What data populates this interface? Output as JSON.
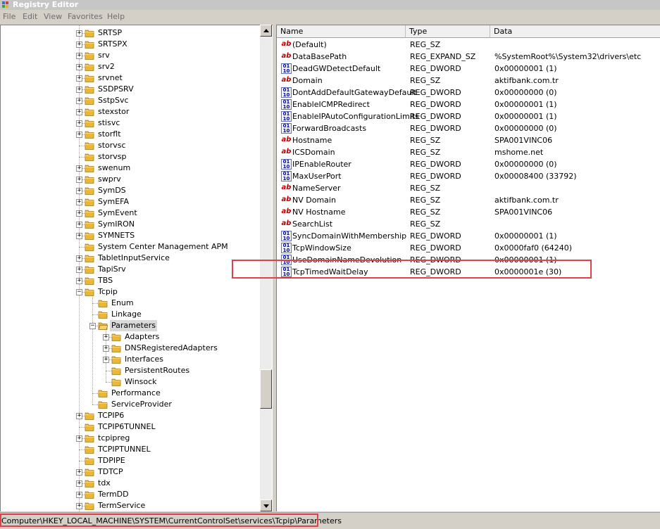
{
  "window": {
    "title": "Registry Editor"
  },
  "menu": [
    "File",
    "Edit",
    "View",
    "Favorites",
    "Help"
  ],
  "tree": [
    {
      "label": "SRTSP",
      "level": 0,
      "expander": "plus"
    },
    {
      "label": "SRTSPX",
      "level": 0,
      "expander": "plus"
    },
    {
      "label": "srv",
      "level": 0,
      "expander": "plus"
    },
    {
      "label": "srv2",
      "level": 0,
      "expander": "plus"
    },
    {
      "label": "srvnet",
      "level": 0,
      "expander": "plus"
    },
    {
      "label": "SSDPSRV",
      "level": 0,
      "expander": "plus"
    },
    {
      "label": "SstpSvc",
      "level": 0,
      "expander": "plus"
    },
    {
      "label": "stexstor",
      "level": 0,
      "expander": "plus"
    },
    {
      "label": "stisvc",
      "level": 0,
      "expander": "plus"
    },
    {
      "label": "storflt",
      "level": 0,
      "expander": "plus"
    },
    {
      "label": "storvsc",
      "level": 0,
      "expander": "none"
    },
    {
      "label": "storvsp",
      "level": 0,
      "expander": "none"
    },
    {
      "label": "swenum",
      "level": 0,
      "expander": "plus"
    },
    {
      "label": "swprv",
      "level": 0,
      "expander": "plus"
    },
    {
      "label": "SymDS",
      "level": 0,
      "expander": "plus"
    },
    {
      "label": "SymEFA",
      "level": 0,
      "expander": "plus"
    },
    {
      "label": "SymEvent",
      "level": 0,
      "expander": "plus"
    },
    {
      "label": "SymIRON",
      "level": 0,
      "expander": "plus"
    },
    {
      "label": "SYMNETS",
      "level": 0,
      "expander": "plus"
    },
    {
      "label": "System Center Management APM",
      "level": 0,
      "expander": "none"
    },
    {
      "label": "TabletInputService",
      "level": 0,
      "expander": "plus"
    },
    {
      "label": "TapiSrv",
      "level": 0,
      "expander": "plus"
    },
    {
      "label": "TBS",
      "level": 0,
      "expander": "plus"
    },
    {
      "label": "Tcpip",
      "level": 0,
      "expander": "minus"
    },
    {
      "label": "Enum",
      "level": 1,
      "expander": "none"
    },
    {
      "label": "Linkage",
      "level": 1,
      "expander": "none"
    },
    {
      "label": "Parameters",
      "level": 1,
      "expander": "minus",
      "selected": true
    },
    {
      "label": "Adapters",
      "level": 2,
      "expander": "plus"
    },
    {
      "label": "DNSRegisteredAdapters",
      "level": 2,
      "expander": "plus"
    },
    {
      "label": "Interfaces",
      "level": 2,
      "expander": "plus"
    },
    {
      "label": "PersistentRoutes",
      "level": 2,
      "expander": "none"
    },
    {
      "label": "Winsock",
      "level": 2,
      "expander": "none"
    },
    {
      "label": "Performance",
      "level": 1,
      "expander": "none"
    },
    {
      "label": "ServiceProvider",
      "level": 1,
      "expander": "none"
    },
    {
      "label": "TCPIP6",
      "level": 0,
      "expander": "plus"
    },
    {
      "label": "TCPIP6TUNNEL",
      "level": 0,
      "expander": "none"
    },
    {
      "label": "tcpipreg",
      "level": 0,
      "expander": "plus"
    },
    {
      "label": "TCPIPTUNNEL",
      "level": 0,
      "expander": "none"
    },
    {
      "label": "TDPIPE",
      "level": 0,
      "expander": "none"
    },
    {
      "label": "TDTCP",
      "level": 0,
      "expander": "plus"
    },
    {
      "label": "tdx",
      "level": 0,
      "expander": "plus"
    },
    {
      "label": "TermDD",
      "level": 0,
      "expander": "plus"
    },
    {
      "label": "TermService",
      "level": 0,
      "expander": "plus"
    }
  ],
  "list_columns": [
    "Name",
    "Type",
    "Data"
  ],
  "values": [
    {
      "icon": "string-value-icon",
      "name": "(Default)",
      "type": "REG_SZ",
      "data": ""
    },
    {
      "icon": "string-value-icon",
      "name": "DataBasePath",
      "type": "REG_EXPAND_SZ",
      "data": "%SystemRoot%\\System32\\drivers\\etc"
    },
    {
      "icon": "binary-value-icon",
      "name": "DeadGWDetectDefault",
      "type": "REG_DWORD",
      "data": "0x00000001 (1)"
    },
    {
      "icon": "string-value-icon",
      "name": "Domain",
      "type": "REG_SZ",
      "data": "aktifbank.com.tr"
    },
    {
      "icon": "binary-value-icon",
      "name": "DontAddDefaultGatewayDefault",
      "type": "REG_DWORD",
      "data": "0x00000000 (0)"
    },
    {
      "icon": "binary-value-icon",
      "name": "EnableICMPRedirect",
      "type": "REG_DWORD",
      "data": "0x00000001 (1)"
    },
    {
      "icon": "binary-value-icon",
      "name": "EnableIPAutoConfigurationLimits",
      "type": "REG_DWORD",
      "data": "0x00000001 (1)"
    },
    {
      "icon": "binary-value-icon",
      "name": "ForwardBroadcasts",
      "type": "REG_DWORD",
      "data": "0x00000000 (0)"
    },
    {
      "icon": "string-value-icon",
      "name": "Hostname",
      "type": "REG_SZ",
      "data": "SPA001VINC06"
    },
    {
      "icon": "string-value-icon",
      "name": "ICSDomain",
      "type": "REG_SZ",
      "data": "mshome.net"
    },
    {
      "icon": "binary-value-icon",
      "name": "IPEnableRouter",
      "type": "REG_DWORD",
      "data": "0x00000000 (0)"
    },
    {
      "icon": "binary-value-icon",
      "name": "MaxUserPort",
      "type": "REG_DWORD",
      "data": "0x00008400 (33792)"
    },
    {
      "icon": "string-value-icon",
      "name": "NameServer",
      "type": "REG_SZ",
      "data": ""
    },
    {
      "icon": "string-value-icon",
      "name": "NV Domain",
      "type": "REG_SZ",
      "data": "aktifbank.com.tr"
    },
    {
      "icon": "string-value-icon",
      "name": "NV Hostname",
      "type": "REG_SZ",
      "data": "SPA001VINC06"
    },
    {
      "icon": "string-value-icon",
      "name": "SearchList",
      "type": "REG_SZ",
      "data": ""
    },
    {
      "icon": "binary-value-icon",
      "name": "SyncDomainWithMembership",
      "type": "REG_DWORD",
      "data": "0x00000001 (1)"
    },
    {
      "icon": "binary-value-icon",
      "name": "TcpWindowSize",
      "type": "REG_DWORD",
      "data": "0x0000faf0 (64240)"
    },
    {
      "icon": "binary-value-icon",
      "name": "UseDomainNameDevolution",
      "type": "REG_DWORD",
      "data": "0x00000001 (1)"
    },
    {
      "icon": "binary-value-icon",
      "name": "TcpTimedWaitDelay",
      "type": "REG_DWORD",
      "data": "0x0000001e (30)",
      "highlighted": true
    }
  ],
  "status": {
    "path": "Computer\\HKEY_LOCAL_MACHINE\\SYSTEM\\CurrentControlSet\\services\\Tcpip\\Parameters"
  },
  "colors": {
    "highlight_box": "#e0404a",
    "selection": "#d9d9d9",
    "folder": "#e8b838"
  }
}
